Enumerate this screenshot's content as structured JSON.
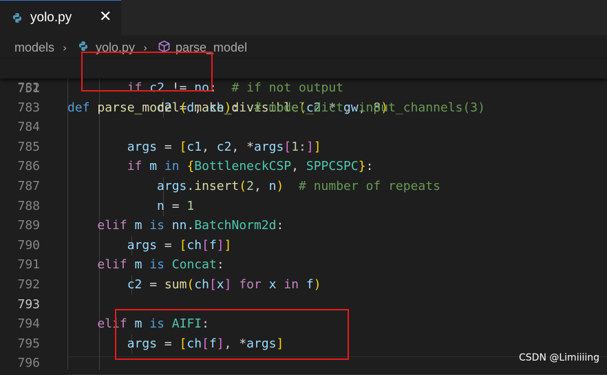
{
  "tab": {
    "filename": "yolo.py",
    "close_glyph": "✕",
    "icon": "python-file-icon"
  },
  "breadcrumb": {
    "folder": "models",
    "sep": "›",
    "file": "yolo.py",
    "symbol": "parse_model"
  },
  "sticky_line": {
    "number": "751",
    "tokens": [
      {
        "t": "def",
        "c": "kw"
      },
      {
        "t": " ",
        "c": ""
      },
      {
        "t": "parse_model",
        "c": "fn"
      },
      {
        "t": "(",
        "c": "br1"
      },
      {
        "t": "d",
        "c": "var"
      },
      {
        "t": ", ",
        "c": ""
      },
      {
        "t": "ch",
        "c": "var"
      },
      {
        "t": ")",
        "c": "br1"
      },
      {
        "t": ":  ",
        "c": ""
      },
      {
        "t": "# model_dict, input_channels(3)",
        "c": "cm"
      }
    ]
  },
  "lines": [
    {
      "number": "782",
      "indent": "        ",
      "tokens": [
        {
          "t": "if",
          "c": "ctl"
        },
        {
          "t": " ",
          "c": ""
        },
        {
          "t": "c2",
          "c": "var"
        },
        {
          "t": " != ",
          "c": ""
        },
        {
          "t": "no",
          "c": "var"
        },
        {
          "t": ":  ",
          "c": ""
        },
        {
          "t": "# if not output",
          "c": "cm"
        }
      ]
    },
    {
      "number": "783",
      "indent": "            ",
      "tokens": [
        {
          "t": "c2",
          "c": "var"
        },
        {
          "t": " = ",
          "c": ""
        },
        {
          "t": "make_divisible",
          "c": "fn"
        },
        {
          "t": "(",
          "c": "br1"
        },
        {
          "t": "c2",
          "c": "var"
        },
        {
          "t": " * ",
          "c": ""
        },
        {
          "t": "gw",
          "c": "var"
        },
        {
          "t": ", ",
          "c": ""
        },
        {
          "t": "8",
          "c": "num"
        },
        {
          "t": ")",
          "c": "br1"
        }
      ]
    },
    {
      "number": "784",
      "indent": "",
      "tokens": []
    },
    {
      "number": "785",
      "indent": "        ",
      "tokens": [
        {
          "t": "args",
          "c": "var"
        },
        {
          "t": " = ",
          "c": ""
        },
        {
          "t": "[",
          "c": "br1"
        },
        {
          "t": "c1",
          "c": "var"
        },
        {
          "t": ", ",
          "c": ""
        },
        {
          "t": "c2",
          "c": "var"
        },
        {
          "t": ", *",
          "c": ""
        },
        {
          "t": "args",
          "c": "var"
        },
        {
          "t": "[",
          "c": "br2"
        },
        {
          "t": "1",
          "c": "num"
        },
        {
          "t": ":",
          "c": ""
        },
        {
          "t": "]",
          "c": "br2"
        },
        {
          "t": "]",
          "c": "br1"
        }
      ]
    },
    {
      "number": "786",
      "indent": "        ",
      "tokens": [
        {
          "t": "if",
          "c": "ctl"
        },
        {
          "t": " ",
          "c": ""
        },
        {
          "t": "m",
          "c": "var"
        },
        {
          "t": " ",
          "c": ""
        },
        {
          "t": "in",
          "c": "kw"
        },
        {
          "t": " ",
          "c": ""
        },
        {
          "t": "{",
          "c": "br1"
        },
        {
          "t": "BottleneckCSP",
          "c": "cls"
        },
        {
          "t": ", ",
          "c": ""
        },
        {
          "t": "SPPCSPC",
          "c": "cls"
        },
        {
          "t": "}",
          "c": "br1"
        },
        {
          "t": ":",
          "c": ""
        }
      ]
    },
    {
      "number": "787",
      "indent": "            ",
      "tokens": [
        {
          "t": "args",
          "c": "var"
        },
        {
          "t": ".",
          "c": ""
        },
        {
          "t": "insert",
          "c": "fn"
        },
        {
          "t": "(",
          "c": "br1"
        },
        {
          "t": "2",
          "c": "num"
        },
        {
          "t": ", ",
          "c": ""
        },
        {
          "t": "n",
          "c": "var"
        },
        {
          "t": ")",
          "c": "br1"
        },
        {
          "t": "  ",
          "c": ""
        },
        {
          "t": "# number of repeats",
          "c": "cm"
        }
      ]
    },
    {
      "number": "788",
      "indent": "            ",
      "tokens": [
        {
          "t": "n",
          "c": "var"
        },
        {
          "t": " = ",
          "c": ""
        },
        {
          "t": "1",
          "c": "num"
        }
      ]
    },
    {
      "number": "789",
      "indent": "    ",
      "tokens": [
        {
          "t": "elif",
          "c": "ctl"
        },
        {
          "t": " ",
          "c": ""
        },
        {
          "t": "m",
          "c": "var"
        },
        {
          "t": " ",
          "c": ""
        },
        {
          "t": "is",
          "c": "kw"
        },
        {
          "t": " ",
          "c": ""
        },
        {
          "t": "nn",
          "c": "var"
        },
        {
          "t": ".",
          "c": ""
        },
        {
          "t": "BatchNorm2d",
          "c": "cls"
        },
        {
          "t": ":",
          "c": ""
        }
      ]
    },
    {
      "number": "790",
      "indent": "        ",
      "tokens": [
        {
          "t": "args",
          "c": "var"
        },
        {
          "t": " = ",
          "c": ""
        },
        {
          "t": "[",
          "c": "br1"
        },
        {
          "t": "ch",
          "c": "var"
        },
        {
          "t": "[",
          "c": "br2"
        },
        {
          "t": "f",
          "c": "var"
        },
        {
          "t": "]",
          "c": "br2"
        },
        {
          "t": "]",
          "c": "br1"
        }
      ]
    },
    {
      "number": "791",
      "indent": "    ",
      "tokens": [
        {
          "t": "elif",
          "c": "ctl"
        },
        {
          "t": " ",
          "c": ""
        },
        {
          "t": "m",
          "c": "var"
        },
        {
          "t": " ",
          "c": ""
        },
        {
          "t": "is",
          "c": "kw"
        },
        {
          "t": " ",
          "c": ""
        },
        {
          "t": "Concat",
          "c": "cls"
        },
        {
          "t": ":",
          "c": ""
        }
      ]
    },
    {
      "number": "792",
      "indent": "        ",
      "tokens": [
        {
          "t": "c2",
          "c": "var"
        },
        {
          "t": " = ",
          "c": ""
        },
        {
          "t": "sum",
          "c": "fn"
        },
        {
          "t": "(",
          "c": "br1"
        },
        {
          "t": "ch",
          "c": "var"
        },
        {
          "t": "[",
          "c": "br2"
        },
        {
          "t": "x",
          "c": "var"
        },
        {
          "t": "]",
          "c": "br2"
        },
        {
          "t": " ",
          "c": ""
        },
        {
          "t": "for",
          "c": "ctl"
        },
        {
          "t": " ",
          "c": ""
        },
        {
          "t": "x",
          "c": "var"
        },
        {
          "t": " ",
          "c": ""
        },
        {
          "t": "in",
          "c": "ctl"
        },
        {
          "t": " ",
          "c": ""
        },
        {
          "t": "f",
          "c": "var"
        },
        {
          "t": ")",
          "c": "br1"
        }
      ]
    },
    {
      "number": "793",
      "indent": "",
      "tokens": [],
      "active": true
    },
    {
      "number": "794",
      "indent": "    ",
      "tokens": [
        {
          "t": "elif",
          "c": "ctl"
        },
        {
          "t": " ",
          "c": ""
        },
        {
          "t": "m",
          "c": "var"
        },
        {
          "t": " ",
          "c": ""
        },
        {
          "t": "is",
          "c": "kw"
        },
        {
          "t": " ",
          "c": ""
        },
        {
          "t": "AIFI",
          "c": "cls"
        },
        {
          "t": ":",
          "c": ""
        }
      ]
    },
    {
      "number": "795",
      "indent": "        ",
      "tokens": [
        {
          "t": "args",
          "c": "var"
        },
        {
          "t": " = ",
          "c": ""
        },
        {
          "t": "[",
          "c": "br1"
        },
        {
          "t": "ch",
          "c": "var"
        },
        {
          "t": "[",
          "c": "br2"
        },
        {
          "t": "f",
          "c": "var"
        },
        {
          "t": "]",
          "c": "br2"
        },
        {
          "t": ", *",
          "c": ""
        },
        {
          "t": "args",
          "c": "var"
        },
        {
          "t": "]",
          "c": "br1"
        }
      ]
    },
    {
      "number": "796",
      "indent": "",
      "tokens": []
    }
  ],
  "watermark": "CSDN @Limiiiing",
  "colors": {
    "accent_tab_border": "#3a78c3",
    "highlight_box": "#e81c1c",
    "editor_bg": "#1e1e1e"
  }
}
